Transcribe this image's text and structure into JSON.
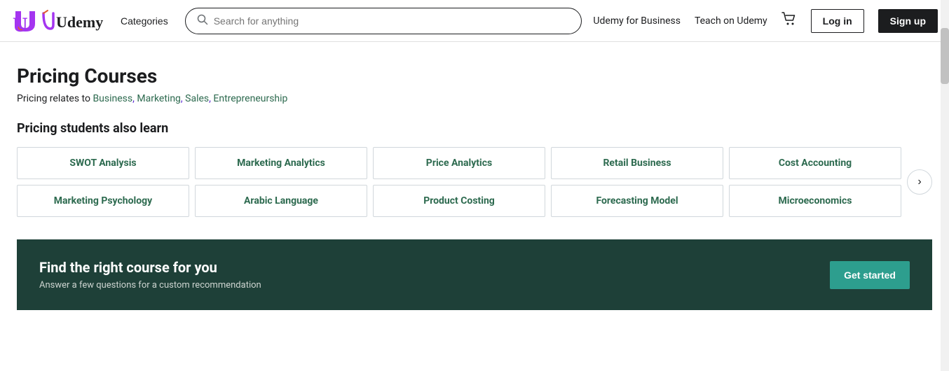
{
  "navbar": {
    "logo_text": "Udemy",
    "categories_label": "Categories",
    "search_placeholder": "Search for anything",
    "udemy_business_label": "Udemy for Business",
    "teach_label": "Teach on Udemy",
    "login_label": "Log in",
    "signup_label": "Sign up"
  },
  "main": {
    "page_title": "Pricing Courses",
    "relates_prefix": "Pricing relates to ",
    "relates_links": "Business, Marketing, Sales, Entrepreneurship",
    "students_also_learn": "Pricing students also learn",
    "tags": [
      {
        "label": "SWOT Analysis"
      },
      {
        "label": "Marketing Analytics"
      },
      {
        "label": "Price Analytics"
      },
      {
        "label": "Retail Business"
      },
      {
        "label": "Cost Accounting"
      },
      {
        "label": "Marketing Psychology"
      },
      {
        "label": "Arabic Language"
      },
      {
        "label": "Product Costing"
      },
      {
        "label": "Forecasting Model"
      },
      {
        "label": "Microeconomics"
      }
    ],
    "arrow_label": "›"
  },
  "banner": {
    "title": "Find the right course for you",
    "subtitle": "Answer a few questions for a custom recommendation",
    "cta_label": "Get started"
  }
}
